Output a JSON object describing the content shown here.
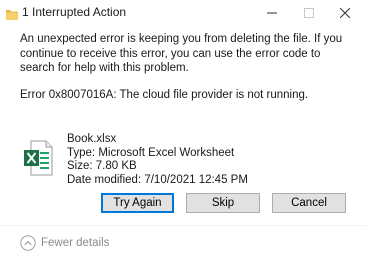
{
  "window": {
    "title": "1 Interrupted Action",
    "controls": {
      "minimize": "minimize-icon",
      "maximize": "maximize-icon",
      "close": "close-icon"
    }
  },
  "message": "An unexpected error is keeping you from deleting the file. If you continue to receive this error, you can use the error code to search for help with this problem.",
  "error_line": "Error 0x8007016A: The cloud file provider is not running.",
  "file": {
    "icon": "excel-file-icon",
    "name": "Book.xlsx",
    "type": "Type: Microsoft Excel Worksheet",
    "size": "Size: 7.80 KB",
    "date_modified": "Date modified: 7/10/2021 12:45 PM"
  },
  "buttons": {
    "try_again": "Try Again",
    "skip": "Skip",
    "cancel": "Cancel"
  },
  "footer": {
    "icon": "chevron-up-circle-icon",
    "label": "Fewer details"
  },
  "colors": {
    "excel_green": "#1e7145",
    "focus_blue": "#0078d7",
    "button_bg": "#e1e1e1"
  }
}
